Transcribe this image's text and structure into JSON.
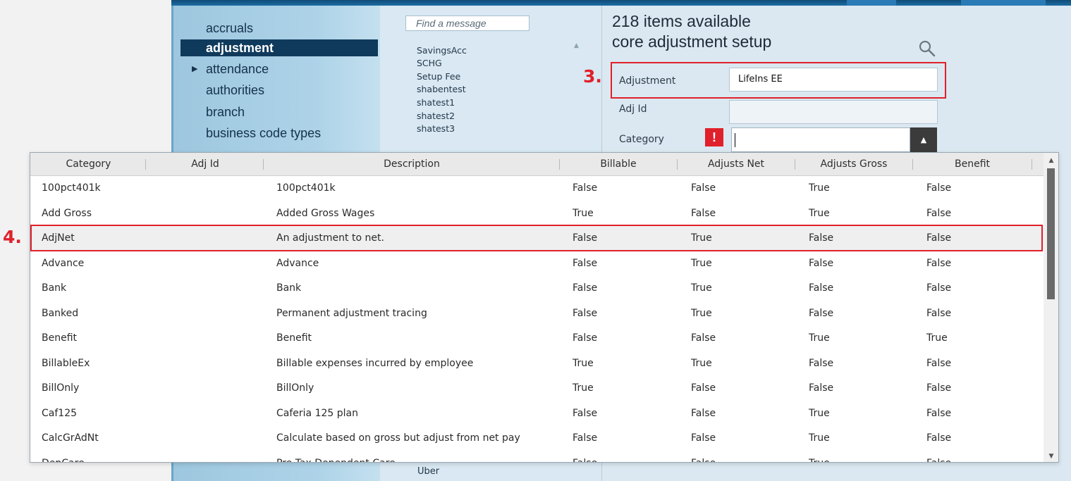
{
  "nav": {
    "items": [
      {
        "label": "accruals",
        "selected": false,
        "expandable": false
      },
      {
        "label": "adjustment",
        "selected": true,
        "expandable": false
      },
      {
        "label": "attendance",
        "selected": false,
        "expandable": true
      },
      {
        "label": "authorities",
        "selected": false,
        "expandable": false
      },
      {
        "label": "branch",
        "selected": false,
        "expandable": false
      },
      {
        "label": "business code types",
        "selected": false,
        "expandable": false
      }
    ]
  },
  "messages": {
    "search_placeholder": "Find a message",
    "items": [
      "SavingsAcc",
      "SCHG",
      "Setup Fee",
      "shabentest",
      "shatest1",
      "shatest2",
      "shatest3"
    ],
    "trailing_item": "Uber"
  },
  "form": {
    "items_available": "218 items available",
    "title": "core adjustment setup",
    "adjustment_label": "Adjustment",
    "adjustment_value": "LifeIns EE",
    "adjid_label": "Adj Id",
    "adjid_value": "",
    "category_label": "Category",
    "category_value": "",
    "warning_glyph": "!",
    "search_icon": "search-icon",
    "dropdown_icon": "triangle-up-icon"
  },
  "annotations": {
    "step3": "3.",
    "step4": "4."
  },
  "table": {
    "columns": [
      "Category",
      "Adj Id",
      "Description",
      "Billable",
      "Adjusts Net",
      "Adjusts Gross",
      "Benefit"
    ],
    "rows": [
      {
        "category": "100pct401k",
        "adjid": "",
        "description": "100pct401k",
        "billable": "False",
        "net": "False",
        "gross": "True",
        "benefit": "False"
      },
      {
        "category": "Add Gross",
        "adjid": "",
        "description": "Added Gross Wages",
        "billable": "True",
        "net": "False",
        "gross": "True",
        "benefit": "False"
      },
      {
        "category": "AdjNet",
        "adjid": "",
        "description": "An adjustment to net.",
        "billable": "False",
        "net": "True",
        "gross": "False",
        "benefit": "False"
      },
      {
        "category": "Advance",
        "adjid": "",
        "description": "Advance",
        "billable": "False",
        "net": "True",
        "gross": "False",
        "benefit": "False"
      },
      {
        "category": "Bank",
        "adjid": "",
        "description": "Bank",
        "billable": "False",
        "net": "True",
        "gross": "False",
        "benefit": "False"
      },
      {
        "category": "Banked",
        "adjid": "",
        "description": "Permanent adjustment tracing",
        "billable": "False",
        "net": "True",
        "gross": "False",
        "benefit": "False"
      },
      {
        "category": "Benefit",
        "adjid": "",
        "description": "Benefit",
        "billable": "False",
        "net": "False",
        "gross": "True",
        "benefit": "True"
      },
      {
        "category": "BillableEx",
        "adjid": "",
        "description": "Billable expenses incurred by employee",
        "billable": "True",
        "net": "True",
        "gross": "False",
        "benefit": "False"
      },
      {
        "category": "BillOnly",
        "adjid": "",
        "description": "BillOnly",
        "billable": "True",
        "net": "False",
        "gross": "False",
        "benefit": "False"
      },
      {
        "category": "Caf125",
        "adjid": "",
        "description": "Caferia 125 plan",
        "billable": "False",
        "net": "False",
        "gross": "True",
        "benefit": "False"
      },
      {
        "category": "CalcGrAdNt",
        "adjid": "",
        "description": "Calculate based on gross but adjust from net pay",
        "billable": "False",
        "net": "False",
        "gross": "True",
        "benefit": "False"
      },
      {
        "category": "DepCare",
        "adjid": "",
        "description": "Pre Tax Dependent Care",
        "billable": "False",
        "net": "False",
        "gross": "True",
        "benefit": "False"
      }
    ],
    "selected_row": 2
  },
  "colors": {
    "accent_red": "#e0202a",
    "nav_selected": "#0f3a5c"
  }
}
